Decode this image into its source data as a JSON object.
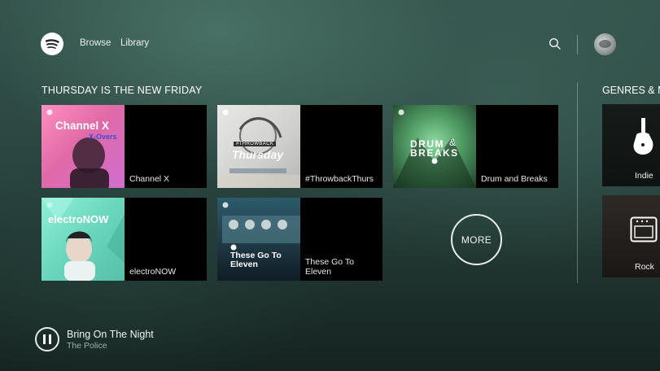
{
  "header": {
    "nav": [
      {
        "label": "Browse"
      },
      {
        "label": "Library"
      }
    ],
    "icons": {
      "logo": "spotify-logo-icon",
      "search": "search-icon",
      "avatar": "user-avatar"
    }
  },
  "section": {
    "title": "THURSDAY IS THE NEW FRIDAY",
    "more_label": "MORE",
    "playlists": [
      {
        "label": "Channel X",
        "art_title": "Channel X",
        "art_subtitle": "X-Overs",
        "accent": "#e06aa7"
      },
      {
        "label": "#ThrowbackThurs",
        "art_small": "#THROWBACK",
        "art_title": "Thursday",
        "accent": "#cfd0cd"
      },
      {
        "label": "Drum and Breaks",
        "art_title_1": "DRUM",
        "art_amp": "&",
        "art_title_2": "BREAKS",
        "accent": "#4f9a63"
      },
      {
        "label": "electroNOW",
        "art_title": "electroNOW",
        "accent": "#6ad6bc"
      },
      {
        "label": "These Go To Eleven",
        "art_title": "These Go To Eleven",
        "accent": "#2c5b6a"
      }
    ]
  },
  "genres": {
    "title": "GENRES & M",
    "items": [
      {
        "label": "Indie",
        "icon": "guitar-icon"
      },
      {
        "label": "Rock",
        "icon": "amplifier-icon"
      }
    ]
  },
  "player": {
    "track": "Bring On The Night",
    "artist": "The Police",
    "state": "playing"
  }
}
